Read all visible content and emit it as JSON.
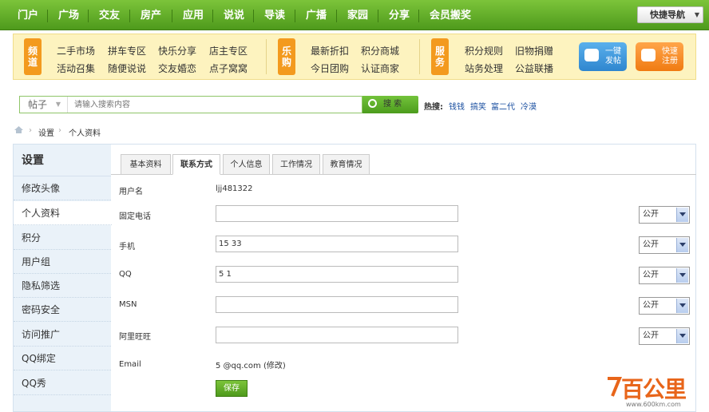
{
  "topnav": {
    "items": [
      "门户",
      "广场",
      "交友",
      "房产",
      "应用",
      "说说",
      "导读",
      "广播",
      "家园",
      "分享",
      "会员搬奖"
    ],
    "quicknav": "快捷导航"
  },
  "channel": {
    "group1_badge": "频道",
    "group1_items": [
      "二手市场",
      "拼车专区",
      "快乐分享",
      "店主专区",
      "活动召集",
      "随便说说",
      "交友婚恋",
      "点子窝窝"
    ],
    "group2_badge": "乐购",
    "group2_items": [
      "最新折扣",
      "积分商城",
      "今日团购",
      "认证商家"
    ],
    "group3_badge": "服务",
    "group3_items": [
      "积分规则",
      "旧物捐赠",
      "站务处理",
      "公益联播"
    ],
    "post_btn": "一键发帖",
    "register_btn": "快速注册"
  },
  "search": {
    "type": "帖子",
    "placeholder": "请输入搜索内容",
    "button": "搜 索",
    "hot_label": "热搜:",
    "hot_terms": [
      "钱钱",
      "搞笑",
      "富二代",
      "冷漠"
    ]
  },
  "breadcrumb": [
    "设置",
    "个人资料"
  ],
  "sidebar": {
    "title": "设置",
    "items": [
      "修改头像",
      "个人资料",
      "积分",
      "用户组",
      "隐私筛选",
      "密码安全",
      "访问推广",
      "QQ绑定",
      "QQ秀"
    ]
  },
  "tabs": [
    "基本资料",
    "联系方式",
    "个人信息",
    "工作情况",
    "教育情况"
  ],
  "form": {
    "username_label": "用户名",
    "username_value": "ljj481322",
    "phone_label": "固定电话",
    "phone_value": "",
    "mobile_label": "手机",
    "mobile_value": "15          33",
    "qq_label": "QQ",
    "qq_value": "5          1",
    "msn_label": "MSN",
    "msn_value": "",
    "wangwang_label": "阿里旺旺",
    "wangwang_value": "",
    "email_label": "Email",
    "email_value": "5          @qq.com (修改)",
    "privacy_option": "公开",
    "save": "保存"
  },
  "watermark": {
    "brand": "百公里",
    "url": "www.600km.com"
  },
  "colors": {
    "nav_green": "#5aa925",
    "accent_orange": "#f39a1e",
    "link_blue": "#1a4fa0"
  }
}
